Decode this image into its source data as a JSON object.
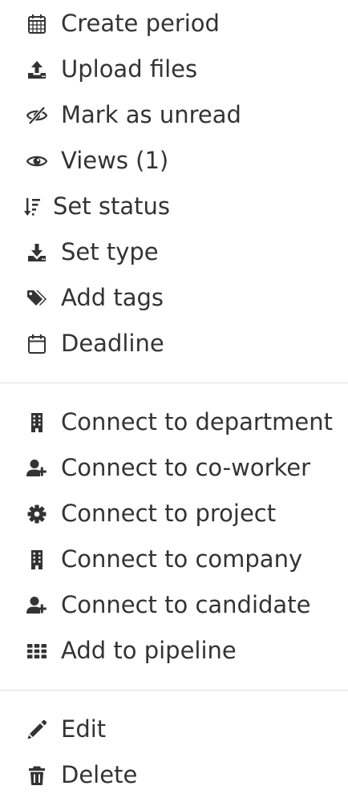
{
  "menu": {
    "group1": [
      {
        "label": "Create period",
        "icon": "calendar-grid-icon"
      },
      {
        "label": "Upload files",
        "icon": "upload-icon"
      },
      {
        "label": "Mark as unread",
        "icon": "eye-slash-icon"
      },
      {
        "label": "Views (1)",
        "icon": "eye-icon"
      },
      {
        "label": "Set status",
        "icon": "sort-amount-down-icon"
      },
      {
        "label": "Set type",
        "icon": "download-icon"
      },
      {
        "label": "Add tags",
        "icon": "tags-icon"
      },
      {
        "label": "Deadline",
        "icon": "calendar-icon"
      }
    ],
    "group2": [
      {
        "label": "Connect to department",
        "icon": "building-icon"
      },
      {
        "label": "Connect to co-worker",
        "icon": "user-plus-icon"
      },
      {
        "label": "Connect to project",
        "icon": "gear-icon"
      },
      {
        "label": "Connect to company",
        "icon": "building-icon"
      },
      {
        "label": "Connect to candidate",
        "icon": "user-plus-icon"
      },
      {
        "label": "Add to pipeline",
        "icon": "grid-icon"
      }
    ],
    "group3": [
      {
        "label": "Edit",
        "icon": "pencil-icon"
      },
      {
        "label": "Delete",
        "icon": "trash-icon"
      }
    ]
  },
  "colors": {
    "text": "#333333",
    "icon": "#333333",
    "divider": "#dddddd"
  }
}
